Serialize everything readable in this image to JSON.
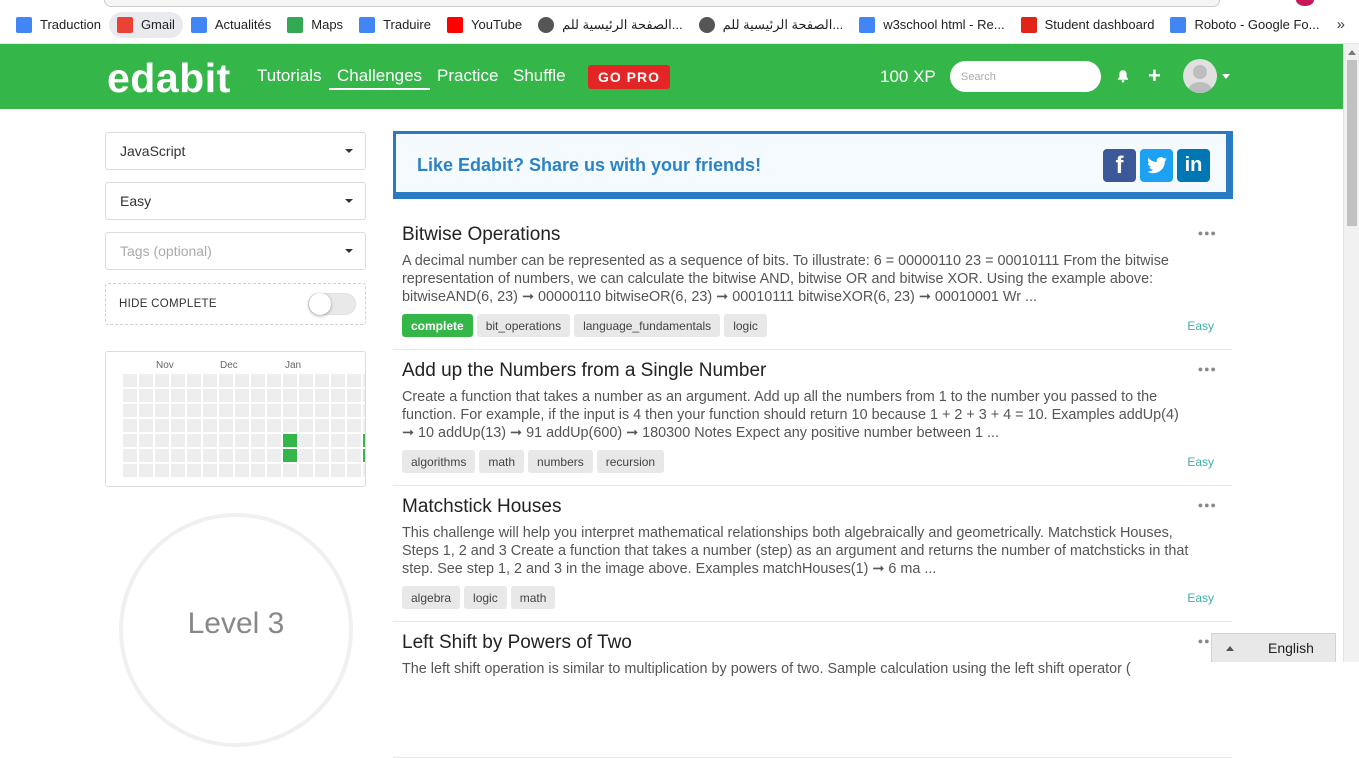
{
  "bookmarks": [
    {
      "label": "Traduction",
      "icon": "google-translate-icon",
      "color": "#4285f4"
    },
    {
      "label": "Gmail",
      "icon": "gmail-icon",
      "color": "#ea4335"
    },
    {
      "label": "Actualités",
      "icon": "google-news-icon",
      "color": "#4285f4"
    },
    {
      "label": "Maps",
      "icon": "google-maps-icon",
      "color": "#34a853"
    },
    {
      "label": "Traduire",
      "icon": "google-translate-icon",
      "color": "#4285f4"
    },
    {
      "label": "YouTube",
      "icon": "youtube-icon",
      "color": "#ff0000"
    },
    {
      "label": "الصفحة الرئيسية للم...",
      "icon": "globe-icon",
      "color": "#555555"
    },
    {
      "label": "الصفحة الرئيسية للم...",
      "icon": "globe-icon",
      "color": "#555555"
    },
    {
      "label": "w3school html - Re...",
      "icon": "google-icon",
      "color": "#4285f4"
    },
    {
      "label": "Student dashboard",
      "icon": "student-dashboard-icon",
      "color": "#e2231a"
    },
    {
      "label": "Roboto - Google Fo...",
      "icon": "google-fonts-icon",
      "color": "#4285f4"
    }
  ],
  "bookmarks_more": "»",
  "header": {
    "logo": "edabit",
    "nav": [
      "Tutorials",
      "Challenges",
      "Practice",
      "Shuffle"
    ],
    "active_nav": "Challenges",
    "gopro": "GO PRO",
    "xp": "100 XP",
    "search_placeholder": "Search",
    "brand_color": "#35b649"
  },
  "filters": {
    "language": "JavaScript",
    "difficulty": "Easy",
    "tags_placeholder": "Tags (optional)",
    "hide_complete_label": "HIDE COMPLETE",
    "hide_complete_on": false
  },
  "heatmap": {
    "months": [
      "Nov",
      "Dec",
      "Jan"
    ],
    "active_color": "#35b649"
  },
  "level": {
    "text": "Level 3"
  },
  "share": {
    "text": "Like Edabit? Share us with your friends!"
  },
  "challenges": [
    {
      "title": "Bitwise Operations",
      "description": "A decimal number can be represented as a sequence of bits. To illustrate: 6 = 00000110 23 = 00010111 From the bitwise representation of numbers, we can calculate the bitwise AND, bitwise OR and bitwise XOR. Using the example above: bitwiseAND(6, 23) ➞ 00000110 bitwiseOR(6, 23) ➞ 00010111 bitwiseXOR(6, 23) ➞ 00010001 Wr ...",
      "tags": [
        "complete",
        "bit_operations",
        "language_fundamentals",
        "logic"
      ],
      "difficulty": "Easy"
    },
    {
      "title": "Add up the Numbers from a Single Number",
      "description": "Create a function that takes a number as an argument. Add up all the numbers from 1 to the number you passed to the function. For example, if the input is 4 then your function should return 10 because 1 + 2 + 3 + 4 = 10. Examples addUp(4) ➞ 10 addUp(13) ➞ 91 addUp(600) ➞ 180300 Notes Expect any positive number between 1 ...",
      "tags": [
        "algorithms",
        "math",
        "numbers",
        "recursion"
      ],
      "difficulty": "Easy"
    },
    {
      "title": "Matchstick Houses",
      "description": "This challenge will help you interpret mathematical relationships both algebraically and geometrically. Matchstick Houses, Steps 1, 2 and 3 Create a function that takes a number (step) as an argument and returns the number of matchsticks in that step. See step 1, 2 and 3 in the image above. Examples matchHouses(1) ➞ 6 ma ...",
      "tags": [
        "algebra",
        "logic",
        "math"
      ],
      "difficulty": "Easy"
    },
    {
      "title": "Left Shift by Powers of Two",
      "description": "The left shift operation is similar to multiplication by powers of two. Sample calculation using the left shift operator (",
      "tags": [],
      "difficulty": ""
    }
  ],
  "language_widget": {
    "label": "English"
  }
}
